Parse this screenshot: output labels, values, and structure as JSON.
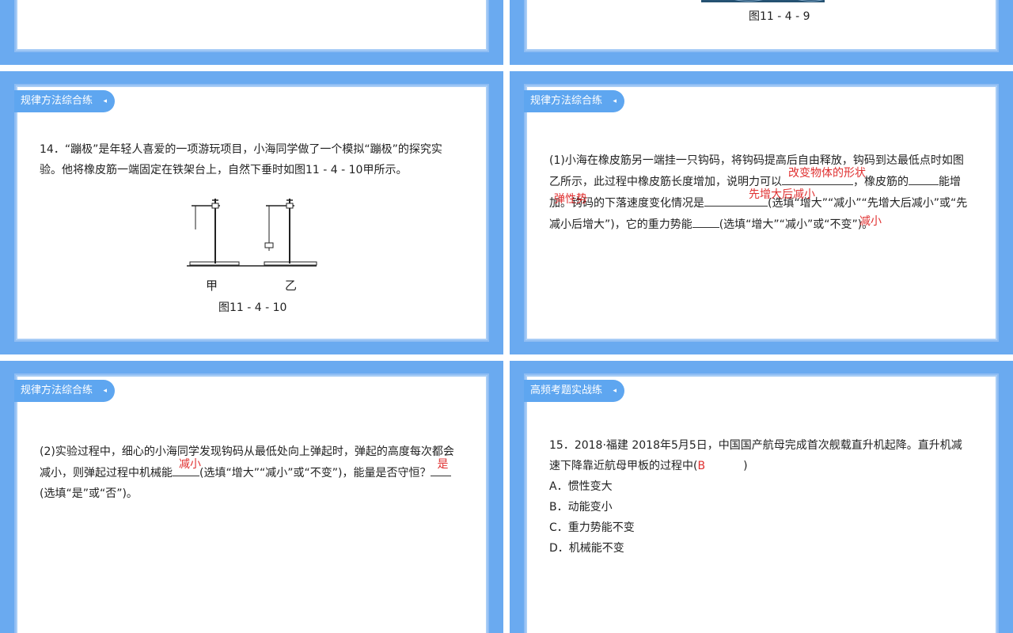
{
  "top_right_caption": "图11 - 4 - 9",
  "slide_mid_left": {
    "tag": "规律方法综合练",
    "tag_arrow": "◂",
    "text": "14．“蹦极”是年轻人喜爱的一项游玩项目，小海同学做了一个模拟“蹦极”的探究实验。他将橡皮筋一端固定在铁架台上，自然下垂时如图11 - 4 - 10甲所示。",
    "label_a": "甲",
    "label_b": "乙",
    "caption": "图11 - 4 - 10"
  },
  "slide_mid_right": {
    "tag": "规律方法综合练",
    "tag_arrow": "◂",
    "part1": "(1)小海在橡皮筋另一端挂一只钩码，将钩码提高后自由释放，钩码到达最低点时如图乙所示，此过程中橡皮筋长度增加，说明力可以",
    "part2": "，橡皮筋的",
    "part3": "能增加。钩码的下落速度变化情况是",
    "part4": "(选填“增大”“减小”“先增大后减小”或“先减小后增大”)，它的重力势能",
    "part5": "(选填“增大”“减小”或“不变”)。",
    "answer1": "改变物体的形状",
    "answer2": "弹性势",
    "answer3": "先增大后减小",
    "answer4": "减小"
  },
  "slide_bottom_left": {
    "tag": "规律方法综合练",
    "tag_arrow": "◂",
    "part1": "(2)实验过程中，细心的小海同学发现钩码从最低处向上弹起时，弹起的高度每次都会减小，则弹起过程中机械能",
    "part2": "(选填“增大”“减小”或“不变”)，能量是否守恒？",
    "part3": "(选填“是”或“否”)。",
    "answer1": "减小",
    "answer2": "是"
  },
  "slide_bottom_right": {
    "tag": "高频考题实战练",
    "tag_arrow": "◂",
    "question": "15．2018·福建 2018年5月5日，中国国产航母完成首次舰载直升机起降。直升机减速下降靠近航母甲板的过程中(",
    "question_end": ")",
    "answer": "B",
    "options": [
      "A．惯性变大",
      "B．动能变小",
      "C．重力势能不变",
      "D．机械能不变"
    ]
  }
}
